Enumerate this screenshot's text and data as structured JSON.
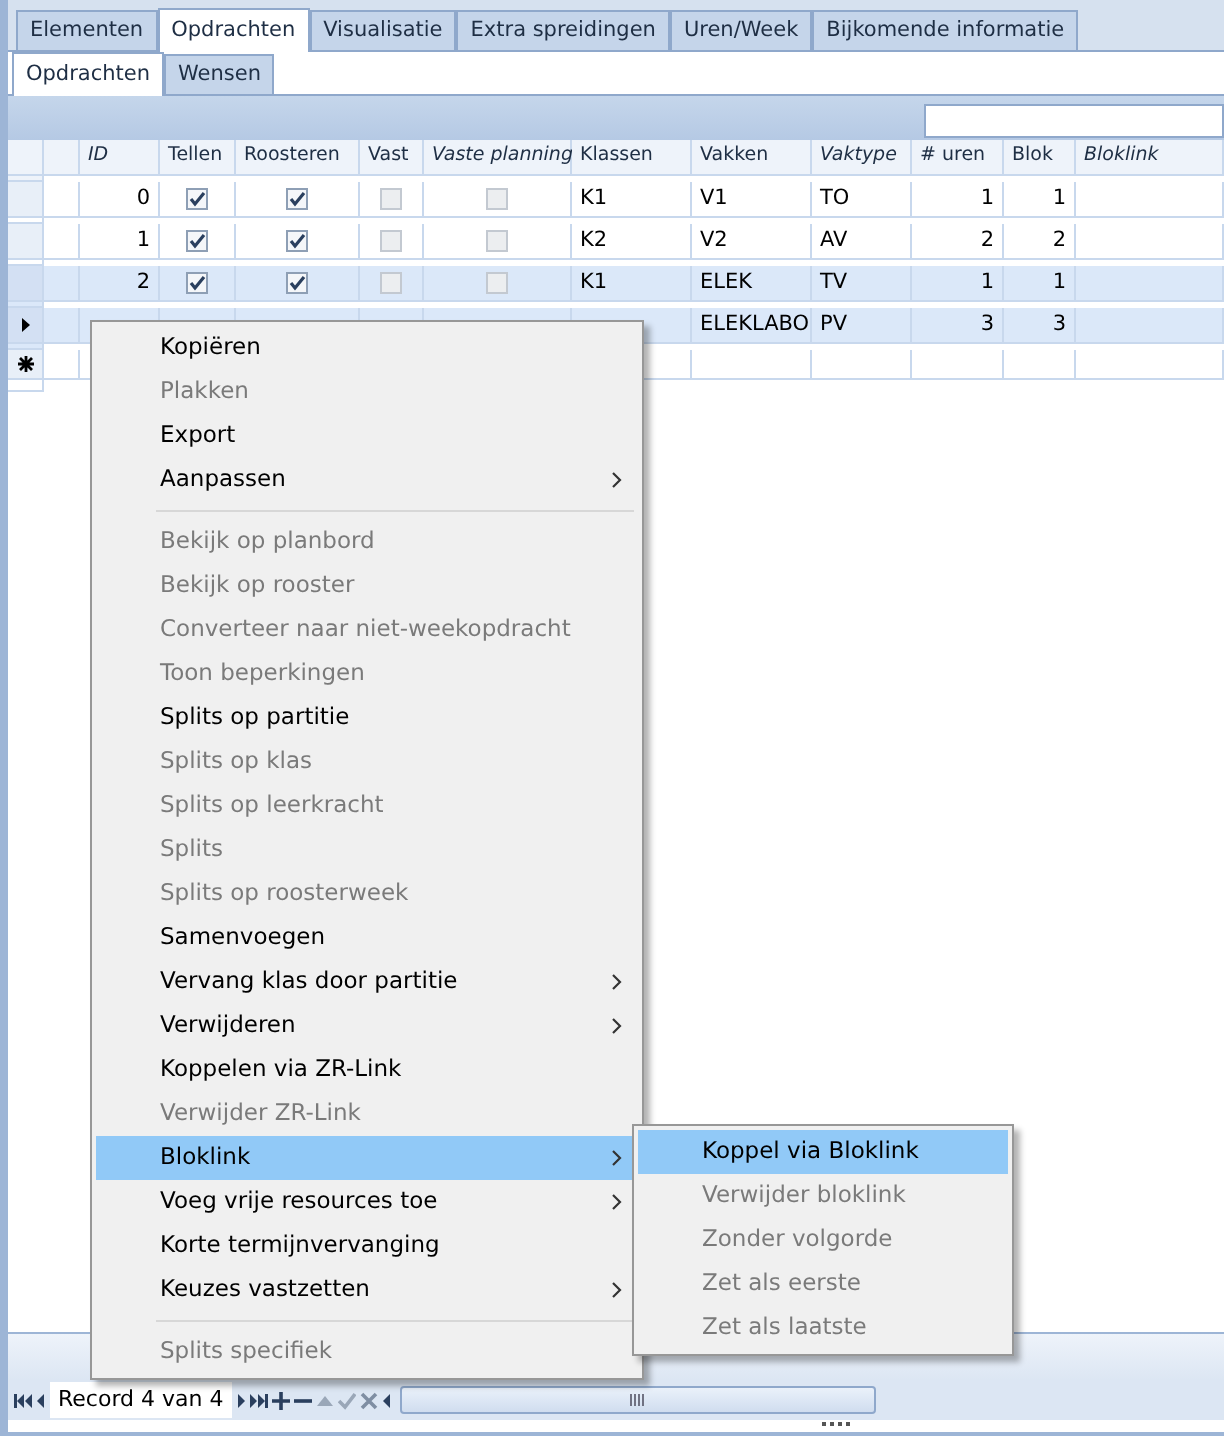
{
  "tabs": [
    {
      "label": "Elementen",
      "selected": false
    },
    {
      "label": "Opdrachten",
      "selected": true
    },
    {
      "label": "Visualisatie",
      "selected": false
    },
    {
      "label": "Extra spreidingen",
      "selected": false
    },
    {
      "label": "Uren/Week",
      "selected": false
    },
    {
      "label": "Bijkomende informatie",
      "selected": false
    }
  ],
  "subtabs": [
    {
      "label": "Opdrachten",
      "selected": true
    },
    {
      "label": "Wensen",
      "selected": false
    }
  ],
  "grid": {
    "columns": [
      {
        "label": "ID",
        "italic": true,
        "kind": "number"
      },
      {
        "label": "Tellen",
        "italic": false,
        "kind": "check"
      },
      {
        "label": "Roosteren",
        "italic": false,
        "kind": "check"
      },
      {
        "label": "Vast",
        "italic": false,
        "kind": "check"
      },
      {
        "label": "Vaste planning",
        "italic": true,
        "kind": "check"
      },
      {
        "label": "Klassen",
        "italic": false,
        "kind": "text"
      },
      {
        "label": "Vakken",
        "italic": false,
        "kind": "text"
      },
      {
        "label": "Vaktype",
        "italic": true,
        "kind": "text"
      },
      {
        "label": "# uren",
        "italic": false,
        "kind": "number"
      },
      {
        "label": "Blok",
        "italic": false,
        "kind": "number"
      },
      {
        "label": "Bloklink",
        "italic": true,
        "kind": "text"
      }
    ],
    "rows": [
      {
        "kind": "data",
        "selected": false,
        "current": false,
        "cells": [
          "0",
          {
            "checked": true
          },
          {
            "checked": true
          },
          {
            "checked": false
          },
          {
            "checked": false
          },
          "K1",
          "V1",
          "TO",
          "1",
          "1",
          null
        ]
      },
      {
        "kind": "data",
        "selected": false,
        "current": false,
        "cells": [
          "1",
          {
            "checked": true
          },
          {
            "checked": true
          },
          {
            "checked": false
          },
          {
            "checked": false
          },
          "K2",
          "V2",
          "AV",
          "2",
          "2",
          null
        ]
      },
      {
        "kind": "data",
        "selected": true,
        "current": false,
        "cells": [
          "2",
          {
            "checked": true
          },
          {
            "checked": true
          },
          {
            "checked": false
          },
          {
            "checked": false
          },
          "K1",
          "ELEK",
          "TV",
          "1",
          "1",
          null
        ]
      },
      {
        "kind": "data",
        "selected": true,
        "current": true,
        "cells": [
          null,
          null,
          null,
          null,
          null,
          null,
          "ELEKLABO",
          "PV",
          "3",
          "3",
          null
        ]
      },
      {
        "kind": "new",
        "cells": []
      }
    ]
  },
  "context_menu": [
    {
      "kind": "item",
      "label": "Kopiëren",
      "disabled": false,
      "submenu": false,
      "selected": false
    },
    {
      "kind": "item",
      "label": "Plakken",
      "disabled": true,
      "submenu": false,
      "selected": false
    },
    {
      "kind": "item",
      "label": "Export",
      "disabled": false,
      "submenu": false,
      "selected": false
    },
    {
      "kind": "item",
      "label": "Aanpassen",
      "disabled": false,
      "submenu": true,
      "selected": false
    },
    {
      "kind": "separator"
    },
    {
      "kind": "item",
      "label": "Bekijk op planbord",
      "disabled": true,
      "submenu": false,
      "selected": false
    },
    {
      "kind": "item",
      "label": "Bekijk op rooster",
      "disabled": true,
      "submenu": false,
      "selected": false
    },
    {
      "kind": "item",
      "label": "Converteer naar niet-weekopdracht",
      "disabled": true,
      "submenu": false,
      "selected": false
    },
    {
      "kind": "item",
      "label": "Toon beperkingen",
      "disabled": true,
      "submenu": false,
      "selected": false
    },
    {
      "kind": "item",
      "label": "Splits op partitie",
      "disabled": false,
      "submenu": false,
      "selected": false
    },
    {
      "kind": "item",
      "label": "Splits op klas",
      "disabled": true,
      "submenu": false,
      "selected": false
    },
    {
      "kind": "item",
      "label": "Splits op leerkracht",
      "disabled": true,
      "submenu": false,
      "selected": false
    },
    {
      "kind": "item",
      "label": "Splits",
      "disabled": true,
      "submenu": false,
      "selected": false
    },
    {
      "kind": "item",
      "label": "Splits op roosterweek",
      "disabled": true,
      "submenu": false,
      "selected": false
    },
    {
      "kind": "item",
      "label": "Samenvoegen",
      "disabled": false,
      "submenu": false,
      "selected": false
    },
    {
      "kind": "item",
      "label": "Vervang klas door partitie",
      "disabled": false,
      "submenu": true,
      "selected": false
    },
    {
      "kind": "item",
      "label": "Verwijderen",
      "disabled": false,
      "submenu": true,
      "selected": false
    },
    {
      "kind": "item",
      "label": "Koppelen via ZR-Link",
      "disabled": false,
      "submenu": false,
      "selected": false
    },
    {
      "kind": "item",
      "label": "Verwijder ZR-Link",
      "disabled": true,
      "submenu": false,
      "selected": false
    },
    {
      "kind": "item",
      "label": "Bloklink",
      "disabled": false,
      "submenu": true,
      "selected": true
    },
    {
      "kind": "item",
      "label": "Voeg vrije resources toe",
      "disabled": false,
      "submenu": true,
      "selected": false
    },
    {
      "kind": "item",
      "label": "Korte termijnvervanging",
      "disabled": false,
      "submenu": false,
      "selected": false
    },
    {
      "kind": "item",
      "label": "Keuzes vastzetten",
      "disabled": false,
      "submenu": true,
      "selected": false
    },
    {
      "kind": "separator"
    },
    {
      "kind": "item",
      "label": "Splits specifiek",
      "disabled": true,
      "submenu": false,
      "selected": false
    }
  ],
  "submenu": [
    {
      "label": "Koppel via Bloklink",
      "disabled": false,
      "selected": true
    },
    {
      "label": "Verwijder bloklink",
      "disabled": true,
      "selected": false
    },
    {
      "label": "Zonder volgorde",
      "disabled": true,
      "selected": false
    },
    {
      "label": "Zet als eerste",
      "disabled": true,
      "selected": false
    },
    {
      "label": "Zet als laatste",
      "disabled": true,
      "selected": false
    }
  ],
  "navigator": {
    "record_text": "Record 4 van 4"
  }
}
